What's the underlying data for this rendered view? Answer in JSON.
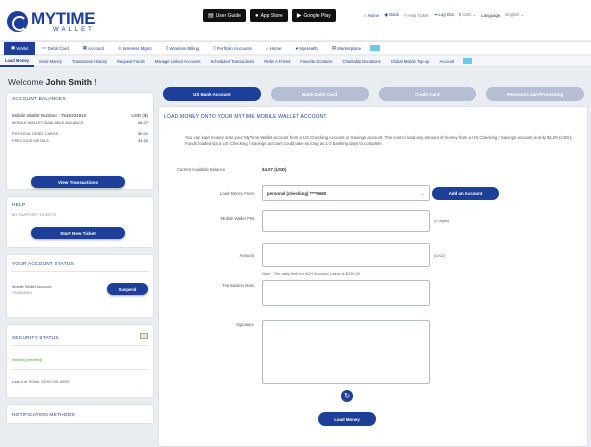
{
  "header": {
    "logo_title": "MYTIME",
    "logo_sub": "WALLET",
    "store_buttons": [
      "User Guide",
      "App Store",
      "Google Play"
    ],
    "links": {
      "home": "Home",
      "back": "Back",
      "help": "Help Ticket",
      "logout": "Log Out",
      "currency": "USD",
      "language_label": "Language",
      "language_value": "English"
    }
  },
  "main_nav": [
    "Wallet",
    "Debit Card",
    "Account",
    "Wireless Mgmt",
    "Wireless Billing",
    "Portfolio Accounts",
    "Home",
    "MyHealth",
    "Marketplace"
  ],
  "sub_nav": [
    "Load Money",
    "Send Money",
    "Transaction History",
    "Request Funds",
    "Manage Linked Accounts",
    "Scheduled Transactions",
    "Refer A Friend",
    "Favorite Contacts",
    "Charitable Donations",
    "Global Mobile Top-up",
    "Account"
  ],
  "left": {
    "welcome_prefix": "Welcome",
    "user_name": "John Smith",
    "welcome_suffix": "!",
    "balances": {
      "title": "ACCOUNT BALANCES",
      "wallet_number_label": "Mobile Wallet Number : 7548331910",
      "wallet_currency": "USD ($)",
      "available_label": "MOBILE WALLET AVAILABLE BALANCE",
      "available_value": "$4.07",
      "debit_cards_label": "PHYSICAL DEBIT CARDS",
      "debit_cards_value": "$0.00",
      "metals_label": "PRECIOUS METALS",
      "metals_value": "$1.55",
      "button": "View Transactions"
    },
    "help": {
      "title": "HELP",
      "tickets_label": "MY SUPPORT TICKETS",
      "button": "Start New Ticket"
    },
    "status": {
      "title": "YOUR ACCOUNT STATUS",
      "wallet_account_label": "Mobile Wallet Account:",
      "wallet_account_value": "754833910",
      "button": "Suspend"
    },
    "security": {
      "title": "SECURITY STATUS",
      "status_text": "existing (verified)",
      "last_login": "Last 4 of SSN#: XXXX-XX-3099"
    },
    "notification": {
      "title": "NOTIFICATION METHODS"
    }
  },
  "tabs": [
    "US Bank Account",
    "Bank Debit Card",
    "Credit Card",
    "Personal Loan Processing"
  ],
  "content": {
    "title": "LOAD MONEY ONTO YOUR MYTIME MOBILE WALLET ACCOUNT",
    "description": "You can load money onto your MyTime Wallet account from a US Checking Account or Savings account. The cost to load any amount of money from a US Checking / Savings account is only $1.00 (USD). Funds loaded via a US Checking / Savings account could take as long as 1-2 banking days to complete.",
    "balance_label": "Current Available Balance",
    "balance_value": "$4.07 (USD)",
    "load_from_label": "Load Money From",
    "load_from_value": "personal (checking) ****5660",
    "add_account_button": "Add an Account",
    "pin_label": "Mobile Wallet PIN",
    "pin_hint": "(4 digits)",
    "amount_label": "Amount",
    "amount_unit": "(USD)",
    "amount_note": "Note : The daily limit for ACH Account Loads is $250.00",
    "transaction_note_label": "Transaction Note",
    "signature_label": "Signature",
    "submit_button": "Load Money"
  }
}
